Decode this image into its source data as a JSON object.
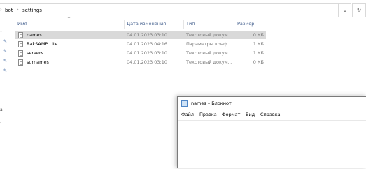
{
  "address_bar": {
    "segments": [
      "bot",
      "settings"
    ],
    "separator": "›",
    "dropdown_icon": "chevron-down-icon",
    "refresh_icon": "refresh-icon"
  },
  "columns": {
    "name": "Имя",
    "date": "Дата изменения",
    "type": "Тип",
    "size": "Размер"
  },
  "files": [
    {
      "name": "names",
      "date": "04.01.2023 03:10",
      "type": "Текстовый докум...",
      "size": "0 КБ",
      "selected": true
    },
    {
      "name": "RakSAMP Lite",
      "date": "04.01.2023 04:16",
      "type": "Параметры конф...",
      "size": "1 КБ",
      "selected": false
    },
    {
      "name": "servers",
      "date": "04.01.2023 03:10",
      "type": "Текстовый докум...",
      "size": "1 КБ",
      "selected": false
    },
    {
      "name": "surnames",
      "date": "04.01.2023 03:10",
      "type": "Текстовый докум...",
      "size": "0 КБ",
      "selected": false
    }
  ],
  "notepad": {
    "title": "names – Блокнот",
    "menu": [
      "Файл",
      "Правка",
      "Формат",
      "Вид",
      "Справка"
    ],
    "content": ""
  },
  "colors": {
    "selected_row": "#d9d9d9",
    "header_text": "#3d5a8a",
    "pin_color": "#4a6fa5"
  }
}
